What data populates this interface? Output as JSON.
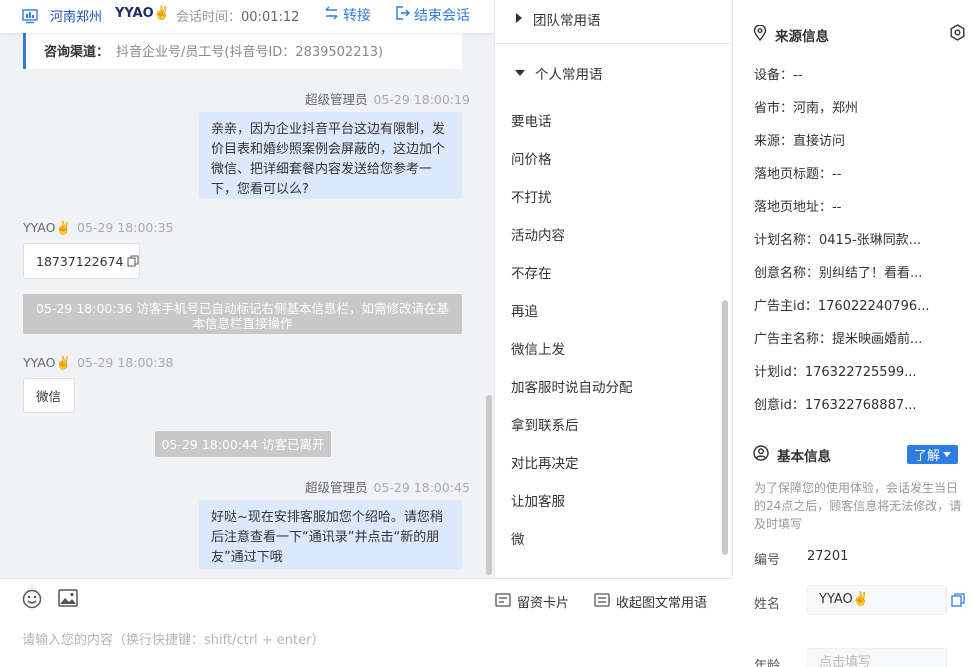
{
  "header": {
    "location": "河南郑州",
    "visitor_name": "YYAO✌️",
    "session_time_label": "会话时间：",
    "session_time": "00:01:12",
    "transfer_label": "转接",
    "end_label": "结束会话"
  },
  "channel": {
    "label": "咨询渠道：",
    "value": "抖音企业号/员工号(抖音号ID：2839502213)"
  },
  "messages": {
    "m1_sender": "超级管理员",
    "m1_time": "05-29 18:00:19",
    "m1_text": "亲亲，因为企业抖音平台这边有限制，发价目表和婚纱照案例会屏蔽的，这边加个微信、把详细套餐内容发送给您参考一下，您看可以么?",
    "m2_sender": "YYAO✌️",
    "m2_time": "05-29 18:00:35",
    "m2_text": "18737122674",
    "sys1": "05-29 18:00:36 访客手机号已自动标记右侧基本信息栏，如需修改请在基本信息栏直接操作",
    "m3_sender": "YYAO✌️",
    "m3_time": "05-29 18:00:38",
    "m3_text": "微信",
    "sys2": "05-29 18:00:44 访客已离开",
    "m4_sender": "超级管理员",
    "m4_time": "05-29 18:00:45",
    "m4_text": "好哒~现在安排客服加您个绍哈。请您稍后注意查看一下“通讯录”并点击“新的朋友”通过下哦"
  },
  "input": {
    "placeholder": "请输入您的内容（换行快捷键：shift/ctrl + enter）",
    "leave_card": "留资卡片",
    "collapse_phrases": "收起图文常用语"
  },
  "phrases": {
    "group_team": "团队常用语",
    "group_personal": "个人常用语",
    "items": [
      "要电话",
      "问价格",
      "不打扰",
      "活动内容",
      "不存在",
      "再追",
      "微信上发",
      "加客服时说自动分配",
      "拿到联系后",
      "对比再决定",
      "让加客服",
      "微"
    ]
  },
  "source": {
    "title": "来源信息",
    "device": "设备：--",
    "region": "省市：河南，郑州",
    "origin": "来源：直接访问",
    "landing_title": "落地页标题：--",
    "landing_url": "落地页地址：--",
    "plan_name": "计划名称：0415-张琳同款...",
    "creative_name": "创意名称：别纠结了！看看...",
    "advertiser_id": "广告主id：176022240796...",
    "advertiser_name": "广告主名称：提米映画婚前...",
    "plan_id": "计划id：176322725599...",
    "creative_id": "创意id：176322768887..."
  },
  "basic": {
    "title": "基本信息",
    "learn_more": "了解",
    "notice": "为了保障您的使用体验，会话发生当日的24点之后，顾客信息将无法修改，请及时填写",
    "number_label": "编号",
    "number_value": "27201",
    "name_label": "姓名",
    "name_value": "YYAO✌️",
    "age_label": "年龄",
    "age_placeholder": "点击填写"
  },
  "colors": {
    "accent": "#2f7de1",
    "agent_bubble": "#dce8fb",
    "chat_bg": "#f0f2f5",
    "system_msg": "#c8c8c8"
  }
}
